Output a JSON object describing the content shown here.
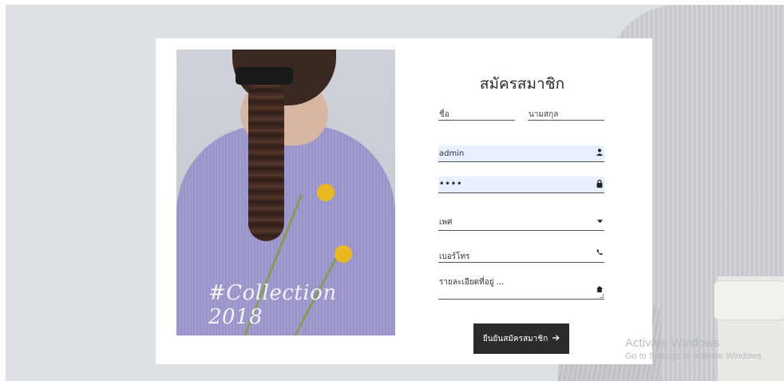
{
  "hero": {
    "caption": "#Collection 2018"
  },
  "form": {
    "title": "สมัครสมาชิก",
    "first_name": {
      "placeholder": "ชื่อ",
      "icon": "none"
    },
    "last_name": {
      "placeholder": "นามสกุล",
      "icon": "none"
    },
    "username": {
      "value": "admin",
      "icon": "user-icon"
    },
    "password": {
      "value": "••••",
      "icon": "lock-icon"
    },
    "gender": {
      "selected": "เพศ",
      "icon": "chevron-down-icon"
    },
    "phone": {
      "placeholder": "เบอร์โทร",
      "icon": "phone-icon"
    },
    "address": {
      "placeholder": "รายละเอียดที่อยู่ ...",
      "icon": "home-icon"
    },
    "submit": {
      "label": "ยืนยันสมัครสมาชิก",
      "icon": "arrow-right-icon"
    }
  },
  "watermark": {
    "line1": "Activate Windows",
    "line2": "Go to Settings to activate Windows."
  },
  "colors": {
    "accent": "#2b2b2b",
    "autofill": "#e8effe",
    "background": "#dde1e6",
    "card": "#ffffff"
  }
}
